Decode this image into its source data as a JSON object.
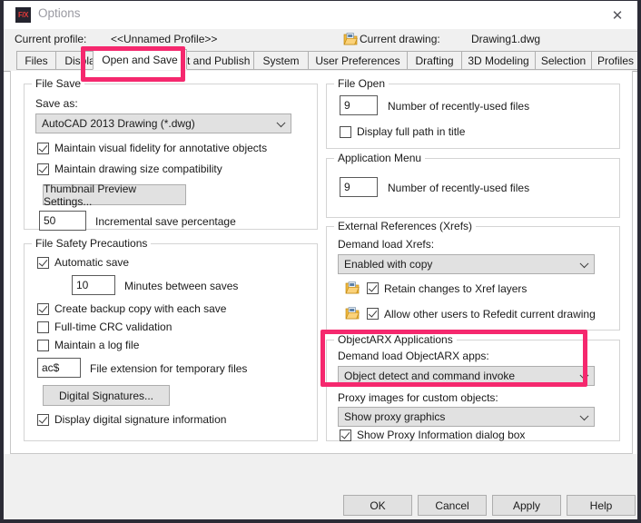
{
  "window": {
    "title": "Options",
    "app_icon": "F/X",
    "close_icon": "close-icon"
  },
  "profile": {
    "profile_label": "Current profile:",
    "profile_value": "<<Unnamed Profile>>",
    "drawing_icon": "drawing-file-icon",
    "drawing_label": "Current drawing:",
    "drawing_value": "Drawing1.dwg"
  },
  "tabs": [
    {
      "label": "Files",
      "selected": false
    },
    {
      "label": "Display",
      "selected": false
    },
    {
      "label": "Open and Save",
      "selected": true
    },
    {
      "label": "Plot and Publish",
      "selected": false
    },
    {
      "label": "System",
      "selected": false
    },
    {
      "label": "User Preferences",
      "selected": false
    },
    {
      "label": "Drafting",
      "selected": false
    },
    {
      "label": "3D Modeling",
      "selected": false
    },
    {
      "label": "Selection",
      "selected": false
    },
    {
      "label": "Profiles",
      "selected": false
    }
  ],
  "file_save": {
    "legend": "File Save",
    "save_as_label": "Save as:",
    "save_as_value": "AutoCAD 2013 Drawing (*.dwg)",
    "maintain_fidelity_label": "Maintain visual fidelity for annotative objects",
    "maintain_fidelity_checked": true,
    "maintain_size_label": "Maintain drawing size compatibility",
    "maintain_size_checked": true,
    "thumbnail_button": "Thumbnail Preview Settings...",
    "incremental_value": "50",
    "incremental_label": "Incremental save percentage"
  },
  "file_safety": {
    "legend": "File Safety Precautions",
    "automatic_save_label": "Automatic save",
    "automatic_save_checked": true,
    "minutes_value": "10",
    "minutes_label": "Minutes between saves",
    "backup_label": "Create backup copy with each save",
    "backup_checked": true,
    "crc_label": "Full-time CRC validation",
    "crc_checked": false,
    "log_label": "Maintain a log file",
    "log_checked": false,
    "temp_ext_value": "ac$",
    "temp_ext_label": "File extension for temporary files",
    "digital_signatures_button": "Digital Signatures...",
    "display_signature_label": "Display digital signature information",
    "display_signature_checked": true
  },
  "file_open": {
    "legend": "File Open",
    "recent_value": "9",
    "recent_label": "Number of recently-used files",
    "full_path_label": "Display full path in title",
    "full_path_checked": false
  },
  "application_menu": {
    "legend": "Application Menu",
    "recent_value": "9",
    "recent_label": "Number of recently-used files"
  },
  "xrefs": {
    "legend": "External References (Xrefs)",
    "demand_load_label": "Demand load Xrefs:",
    "demand_load_value": "Enabled with copy",
    "retain_icon": "xref-layer-icon",
    "retain_label": "Retain changes to Xref layers",
    "retain_checked": true,
    "refedit_icon": "xref-refedit-icon",
    "refedit_label": "Allow other users to Refedit current drawing",
    "refedit_checked": true
  },
  "objectarx": {
    "legend": "ObjectARX Applications",
    "demand_load_label": "Demand load ObjectARX apps:",
    "demand_load_value": "Object detect and command invoke",
    "proxy_images_label": "Proxy images for custom objects:",
    "proxy_images_value": "Show proxy graphics",
    "proxy_dialog_label": "Show Proxy Information dialog box",
    "proxy_dialog_checked": true
  },
  "footer": {
    "ok": "OK",
    "cancel": "Cancel",
    "apply": "Apply",
    "help": "Help"
  },
  "annotations": {
    "highlight_color": "#f5286e",
    "tab_highlight": "Open and Save",
    "objectarx_highlight": "ObjectARX Applications"
  }
}
